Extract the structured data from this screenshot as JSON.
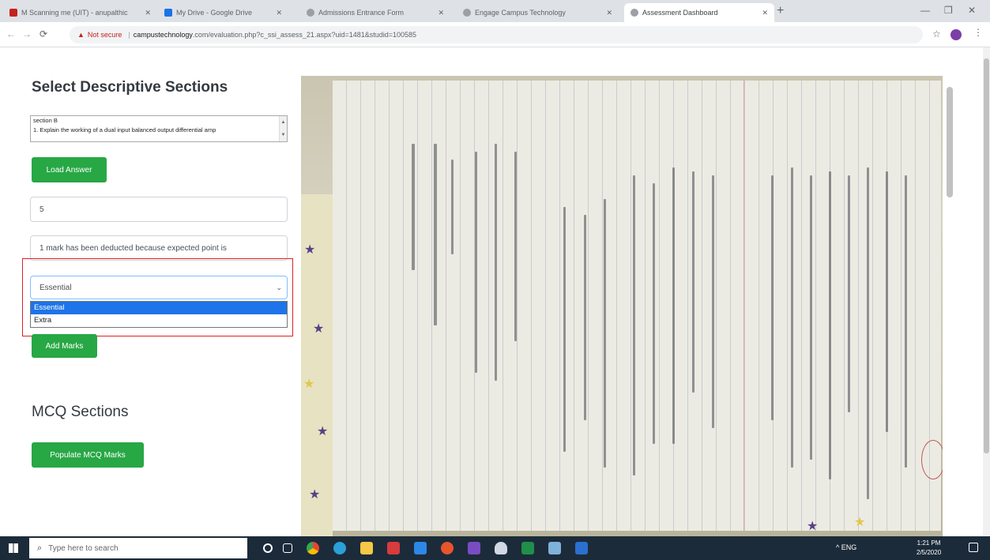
{
  "browser": {
    "tabs": [
      {
        "title": "M Scanning me (UIT) - anupalthic",
        "fav": "#c5221f"
      },
      {
        "title": "My Drive - Google Drive",
        "fav": "#1a73e8"
      },
      {
        "title": "Admissions Entrance Form",
        "fav": "#5f6368"
      },
      {
        "title": "Engage Campus Technology",
        "fav": "#5f6368"
      },
      {
        "title": "Assessment Dashboard",
        "fav": "#5f6368",
        "active": true
      }
    ],
    "url_warning": "Not secure",
    "url_host": "campustechnology",
    "url_rest": ".com/evaluation.php?c_ssi_assess_21.aspx?uid=1481&studid=100585"
  },
  "page": {
    "heading": "Select Descriptive Sections",
    "section_list": [
      "section B",
      "1. Explain the working of a dual input balanced output differential amp"
    ],
    "load_answer_label": "Load Answer",
    "marks_value": "5",
    "remark_value": "1 mark has been deducted because expected point is",
    "marks_type_selected": "Essential",
    "marks_type_options": [
      "Essential",
      "Extra"
    ],
    "add_marks_label": "Add Marks",
    "mcq_heading": "MCQ Sections",
    "populate_mcq_label": "Populate MCQ Marks"
  },
  "taskbar": {
    "search_placeholder": "Type here to search",
    "tray": "^  ENG",
    "time": "1:21 PM",
    "date": "2/5/2020"
  }
}
